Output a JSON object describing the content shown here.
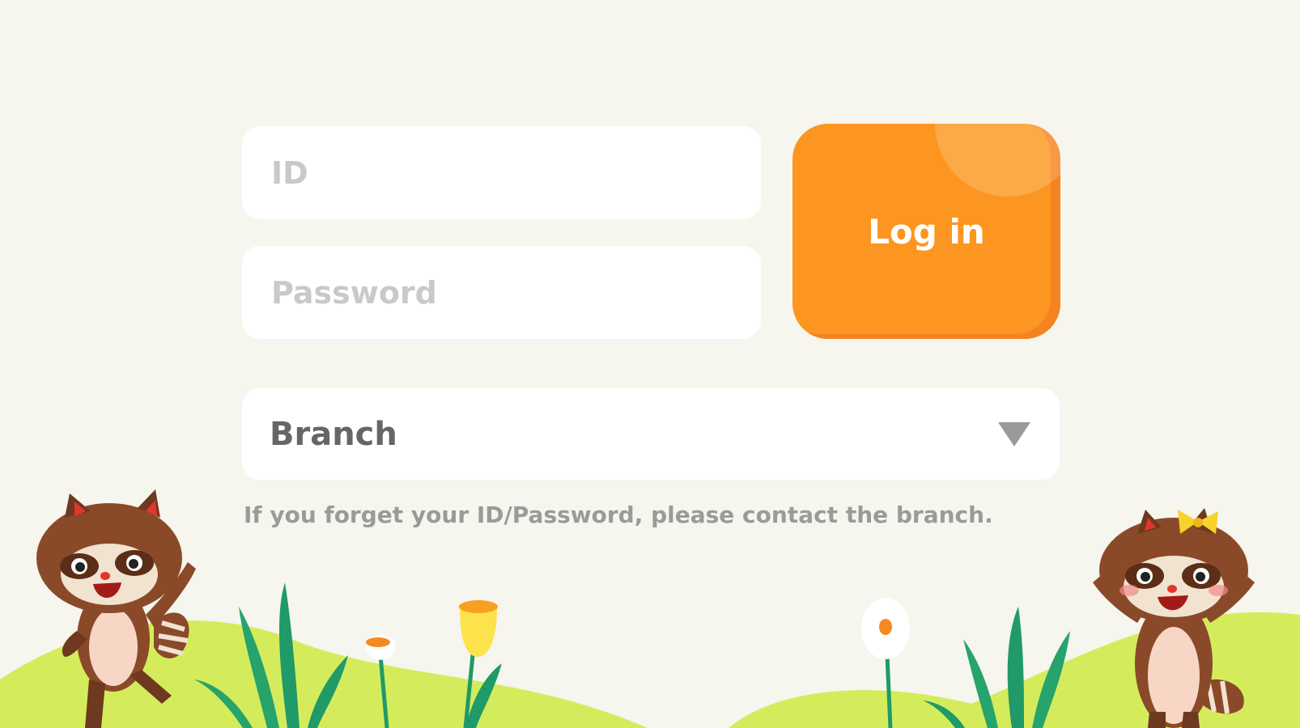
{
  "login_form": {
    "id_placeholder": "ID",
    "password_placeholder": "Password",
    "login_label": "Log in",
    "branch_label": "Branch",
    "help_text": "If you forget your ID/Password, please contact the branch."
  },
  "colors": {
    "background": "#f6f5ee",
    "accent": "#fc9620",
    "hill": "#d4ec5c",
    "leaf": "#1f9a68"
  },
  "icons": {
    "dropdown": "chevron-down-triangle"
  }
}
